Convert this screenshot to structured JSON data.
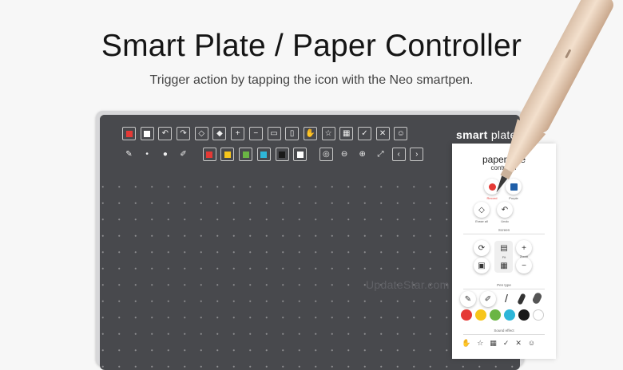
{
  "header": {
    "title": "Smart Plate / Paper Controller",
    "subtitle": "Trigger action by tapping the icon with the Neo smartpen."
  },
  "plate": {
    "brand_light": "smart",
    "brand_bold": "plate",
    "watermark": "UpdateStar.com",
    "row1": [
      {
        "name": "red-square-icon",
        "color": "#e53935"
      },
      {
        "name": "white-square-icon",
        "color": "#ffffff"
      },
      {
        "name": "undo-icon",
        "glyph": "↶"
      },
      {
        "name": "redo-icon",
        "glyph": "↷"
      },
      {
        "name": "eraser-icon",
        "glyph": "◇"
      },
      {
        "name": "eraser-all-icon",
        "glyph": "◆"
      },
      {
        "name": "plus-icon",
        "glyph": "+"
      },
      {
        "name": "minus-icon",
        "glyph": "−"
      },
      {
        "name": "page-icon",
        "glyph": "▭"
      },
      {
        "name": "page-add-icon",
        "glyph": "▯"
      },
      {
        "name": "hand-icon",
        "glyph": "✋"
      },
      {
        "name": "star-icon",
        "glyph": "☆"
      },
      {
        "name": "calendar-icon",
        "glyph": "▦"
      },
      {
        "name": "check-icon",
        "glyph": "✓"
      },
      {
        "name": "close-icon",
        "glyph": "✕"
      },
      {
        "name": "smile-icon",
        "glyph": "☺"
      }
    ],
    "row2": [
      {
        "name": "pen-icon",
        "glyph": "✎",
        "plain": true
      },
      {
        "name": "pen-thin-icon",
        "glyph": "•",
        "plain": true
      },
      {
        "name": "pen-thick-icon",
        "glyph": "●",
        "plain": true
      },
      {
        "name": "marker-icon",
        "glyph": "✐",
        "plain": true
      },
      {
        "name": "gap"
      },
      {
        "name": "color-red-icon",
        "color": "#e53935"
      },
      {
        "name": "color-yellow-icon",
        "color": "#f7c61b"
      },
      {
        "name": "color-green-icon",
        "color": "#6ab544"
      },
      {
        "name": "color-cyan-icon",
        "color": "#2eb6d8"
      },
      {
        "name": "color-black-icon",
        "color": "#1a1a1a"
      },
      {
        "name": "color-white-icon",
        "color": "#ffffff"
      },
      {
        "name": "gap"
      },
      {
        "name": "lasso-icon",
        "glyph": "◎"
      },
      {
        "name": "zoom-out-icon",
        "glyph": "⊖",
        "plain": true
      },
      {
        "name": "zoom-in-icon",
        "glyph": "⊕",
        "plain": true
      },
      {
        "name": "fit-screen-icon",
        "glyph": "⤢",
        "plain": true
      },
      {
        "name": "prev-page-icon",
        "glyph": "‹"
      },
      {
        "name": "next-page-icon",
        "glyph": "›"
      }
    ]
  },
  "controller": {
    "title": "papertube",
    "subtitle": "controller",
    "sections": {
      "scene": "Screen",
      "pen_type": "Pen type",
      "sound": "Sound effect"
    },
    "labels": {
      "record": "Record",
      "purple": "Purple",
      "erase_all": "Erase all",
      "undo": "Undo",
      "fit": "Fit",
      "zoom": "Zoom"
    },
    "colors": [
      "#e53935",
      "#f7c61b",
      "#6ab544",
      "#2eb6d8",
      "#1a1a1a",
      "#ffffff"
    ]
  }
}
